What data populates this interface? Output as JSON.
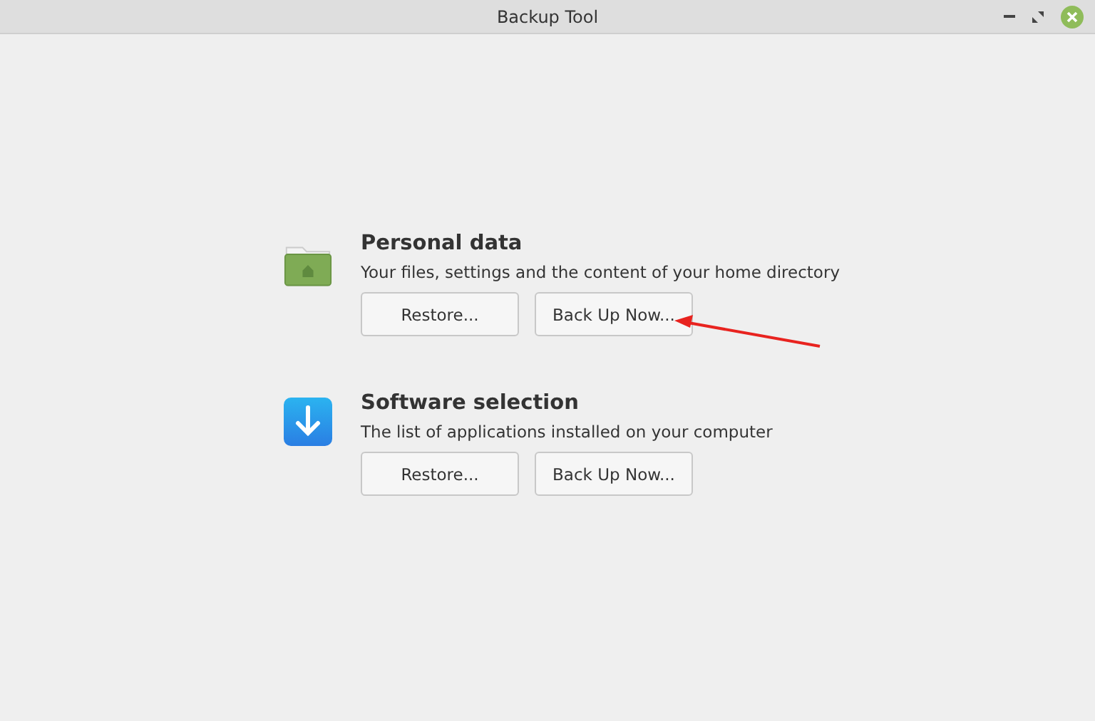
{
  "window": {
    "title": "Backup Tool"
  },
  "sections": [
    {
      "kind": "folder",
      "heading": "Personal data",
      "description": "Your files, settings and the content of your home directory",
      "buttons": [
        "Restore...",
        "Back Up Now..."
      ]
    },
    {
      "kind": "download",
      "heading": "Software selection",
      "description": "The list of applications installed on your computer",
      "buttons": [
        "Restore...",
        "Back Up Now..."
      ]
    }
  ]
}
